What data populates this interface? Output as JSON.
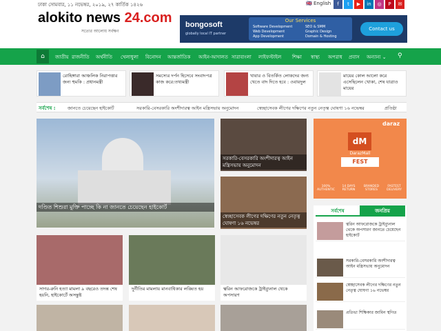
{
  "topbar": {
    "date": "ঢাকা  সোমবার, ১১ নভেম্বর, ২০১৯, ২৭ কার্তিক ১৪২৬",
    "language": "English",
    "social": [
      "f",
      "t",
      "▶",
      "in",
      "◎",
      "P",
      "✉"
    ]
  },
  "logo": {
    "main": "alokito news ",
    "accent": "24.com",
    "tagline": "সত্যের আলোয় সর্বক্ষণ"
  },
  "ad": {
    "brand": "bongosoft",
    "tagline": "globally local IT partner",
    "services_title": "Our Services",
    "services": [
      "Software Development",
      "Web Development",
      "App Development",
      "SEO & SMM",
      "Graphic Design",
      "Domain & Hosting"
    ],
    "cta": "Contact us"
  },
  "nav": {
    "home_icon": "home-icon",
    "items": [
      "জাতীয়",
      "রাজনীতি",
      "অর্থনীতি",
      "খেলাধুলা",
      "বিনোদন",
      "আন্তর্জাতিক",
      "আইন-আদালত",
      "সারাবাংলা",
      "লাইফস্টাইল",
      "শিক্ষা",
      "স্বাস্থ্য",
      "অপরাধ",
      "প্রবাস",
      "অন্যান্য ⌄"
    ],
    "search_icon": "search-icon"
  },
  "top_cards": [
    "রোহিঙ্গারা আঞ্চলিক নিরাপত্তার জন্য হুমকি : প্রধানমন্ত্রী",
    "সমস্যের দর্পন হিসেবে সংবাদপত্র কাজ করে:তথ্যমন্ত্রী",
    "খাবার ও বিতর্কিত লোকদের জন্য খেতে বাদ দিতে হবে : ওবায়দুল",
    "মায়ের কোল আলো করে এসেছিলেন খোকা, শেষ যাত্রাও মায়ের"
  ],
  "ticker": {
    "label": "সর্বশেষ :",
    "items": [
      "জানতে চেয়েছেন হাইকোর্ট",
      "সরকারি-বেসরকারি অংশীদারত্ব আইন মন্ত্রিসভায় অনুমোদন",
      "স্বেচ্ছাসেবক লীগের দক্ষিণের নতুন নেতৃত্ব ঘোষণা ১৬ নভেম্বর",
      "প্রতিষ্ঠা"
    ]
  },
  "hero": {
    "caption": "দণ্ডিত শিশুরা মুক্তি পাচ্ছে কি না জানতে চেয়েছেন হাইকোর্ট"
  },
  "mid_cards": [
    {
      "caption": "সরকারি-বেসরকারি অংশীদারত্ব আইন মন্ত্রিসভায় অনুমোদন"
    },
    {
      "caption": "স্বেচ্ছাসেবক লীগের দক্ষিণের নতুন নেতৃত্ব ঘোষণা ১৬ নভেম্বর"
    }
  ],
  "row_cards": [
    "সাগর-রুনি হত্যা মামলা ৯ বছরেও তদন্ত শেষ হয়নি, হাইকোর্টে অসন্তুষ্ট",
    "দুর্নীতির মামলায় মানবাধিকার লঙ্ঘিত হয়",
    "ত্বরিন আফরোজকে ট্রাইব্যুনাল থেকে অপসারণ"
  ],
  "sidebar": {
    "tab_latest": "সর্বশেষ",
    "tab_popular": "জনপ্রিয়",
    "items": [
      "ত্বরিন আফরোজকে ট্রাইব্যুনাল থেকে অপসারণ জানতে চেয়েছেন হাইকোর্ট",
      "সরকারি-বেসরকারি অংশীদারত্ব আইন মন্ত্রিসভায় অনুমোদন",
      "স্বেচ্ছাসেবক লীগের দক্ষিণের নতুন নেতৃত্ব ঘোষণা ১৬ নভেম্বর",
      "প্রতিভা শিক্ষিকার জামিন স্থগিত"
    ]
  },
  "daraz": {
    "brand": "daraz",
    "logo": "dM",
    "mall": "DarazMall",
    "fest": "FEST",
    "badges": [
      "100% AUTHENTIC",
      "14 DAYS RETURN",
      "BRANDED STORES",
      "FASTEST DELIVERY"
    ]
  },
  "colors": {
    "nav": "#15a34a",
    "accent_red": "#d9201f",
    "ad_bg": "#1d3a68"
  }
}
